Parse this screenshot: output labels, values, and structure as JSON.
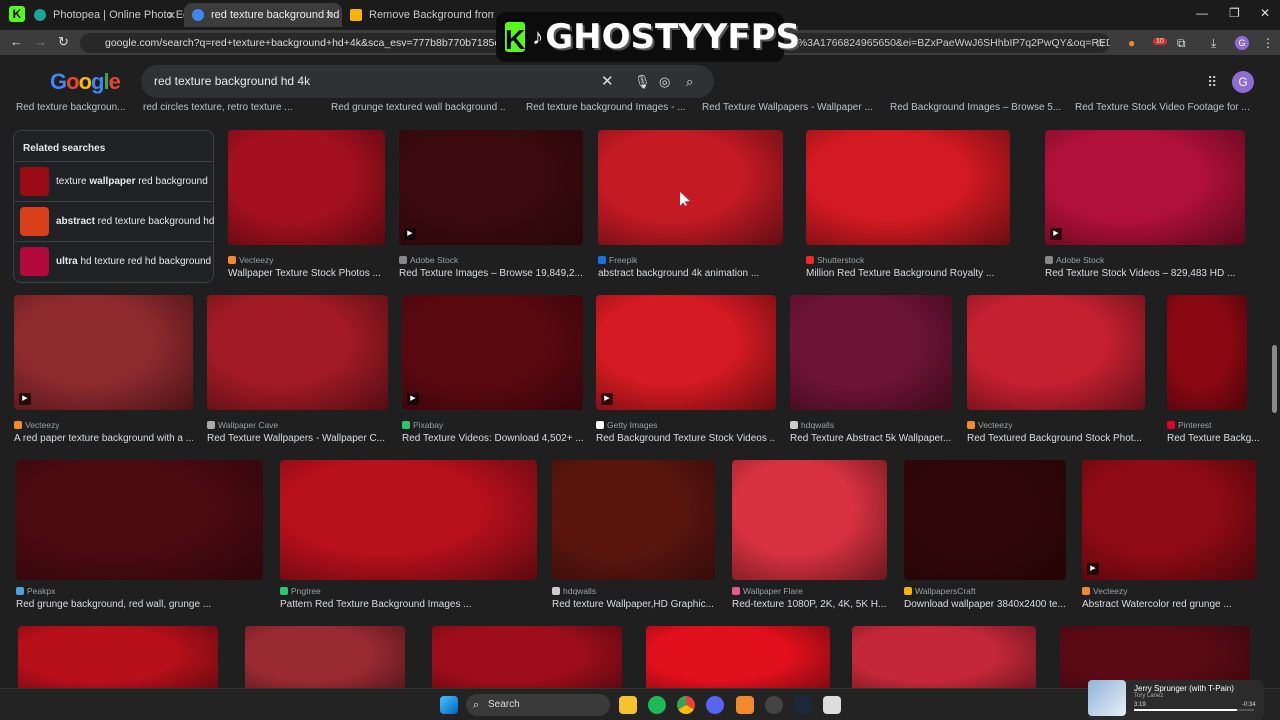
{
  "tabs": [
    {
      "label": "Photopea | Online Photo Editor",
      "color": "#18a497"
    },
    {
      "label": "red texture background hd 4k",
      "color": "#4285f4"
    },
    {
      "label": "Remove Background from Imag",
      "color": "#f4b400"
    }
  ],
  "address": {
    "url": "google.com/search?q=red+texture+background+hd+4k&sca_esv=777b8b770b7185e7&udm=2",
    "url_tail": "g%3A1766824965650&ei=BZxPaeWwJ6SHhbIP7q2PwQY&oq=RED+T...",
    "ext_badge": "10",
    "profile_letter": "G"
  },
  "overlay": {
    "brand": "GHOSTYYFPS",
    "k": "K"
  },
  "google": {
    "logo": "Google",
    "query": "red texture background hd 4k",
    "profile_letter": "G"
  },
  "top_captions": [
    "Red texture backgroun...",
    "red circles texture, retro texture ...",
    "Red grunge textured wall background ...",
    "Red texture background Images - ...",
    "Red Texture Wallpapers - Wallpaper ...",
    "Red Background Images – Browse 5...",
    "Red Texture Stock Video Footage for ..."
  ],
  "related": {
    "heading": "Related searches",
    "items": [
      {
        "pre": "texture ",
        "bold": "wallpaper",
        "post": " red background",
        "color": "#9a0c14"
      },
      {
        "pre": "",
        "bold": "abstract",
        "post": " red texture background hd",
        "color": "#d8401a"
      },
      {
        "pre": "",
        "bold": "ultra",
        "post": " hd texture red hd background",
        "color": "#b10a3a"
      }
    ]
  },
  "rows": [
    [
      {
        "source": "Vecteezy",
        "title": "Wallpaper Texture Stock Photos ...",
        "color": "#a5101e",
        "icon": "#f28b2c",
        "video": false
      },
      {
        "source": "Adobe Stock",
        "title": "Red Texture Images – Browse 19,849,2...",
        "color": "#3a0a0e",
        "icon": "#888",
        "video": true
      },
      {
        "source": "Freepik",
        "title": "abstract background 4k animation ...",
        "color": "#c41a24",
        "icon": "#1273eb",
        "video": false
      },
      {
        "source": "Shutterstock",
        "title": "Million Red Texture Background Royalty ...",
        "color": "#d31a22",
        "icon": "#ee2b24",
        "video": false
      },
      {
        "source": "Adobe Stock",
        "title": "Red Texture Stock Videos – 829,483 HD ...",
        "color": "#b0103a",
        "icon": "#888",
        "video": true
      }
    ],
    [
      {
        "source": "Vecteezy",
        "title": "A red paper texture background with a ...",
        "color": "#8d2a2e",
        "icon": "#f28b2c",
        "video": true
      },
      {
        "source": "Wallpaper Cave",
        "title": "Red Texture Wallpapers - Wallpaper C...",
        "color": "#a11a24",
        "icon": "#aaa",
        "video": false
      },
      {
        "source": "Pixabay",
        "title": "Red Texture Videos: Download 4,502+ ...",
        "color": "#5a0810",
        "icon": "#2ec66d",
        "video": true
      },
      {
        "source": "Getty Images",
        "title": "Red Background Texture Stock Videos ...",
        "color": "#d41a22",
        "icon": "#fff",
        "video": true
      },
      {
        "source": "hdqwalls",
        "title": "Red Texture Abstract 5k Wallpaper...",
        "color": "#6d1436",
        "icon": "#ccc",
        "video": false
      },
      {
        "source": "Vecteezy",
        "title": "Red Textured Background Stock Phot...",
        "color": "#c42030",
        "icon": "#f28b2c",
        "video": false
      },
      {
        "source": "Pinterest",
        "title": "Red Texture Backg...",
        "color": "#8a0812",
        "icon": "#e60023",
        "video": false
      }
    ],
    [
      {
        "source": "Peakpx",
        "title": "Red grunge background, red wall, grunge ...",
        "color": "#4a0a10",
        "icon": "#4aa3df",
        "video": false
      },
      {
        "source": "Pngtree",
        "title": "Pattern Red Texture Background Images ...",
        "color": "#b8101c",
        "icon": "#2ec66d",
        "video": false
      },
      {
        "source": "hdqwalls",
        "title": "Red texture Wallpaper,HD Graphic...",
        "color": "#5a160e",
        "icon": "#ccc",
        "video": false
      },
      {
        "source": "Wallpaper Flare",
        "title": "Red-texture 1080P, 2K, 4K, 5K H...",
        "color": "#d83240",
        "icon": "#e85a8a",
        "video": false
      },
      {
        "source": "WallpapersCraft",
        "title": "Download wallpaper 3840x2400 te...",
        "color": "#300608",
        "icon": "#f4b400",
        "video": false
      },
      {
        "source": "Vecteezy",
        "title": "Abstract Watercolor red grunge ...",
        "color": "#8e0a14",
        "icon": "#f28b2c",
        "video": true
      }
    ],
    [
      {
        "color": "#b8101a"
      },
      {
        "color": "#9a2a32"
      },
      {
        "color": "#9e0e1a"
      },
      {
        "color": "#e0101c"
      },
      {
        "color": "#c42838"
      },
      {
        "color": "#5a0a14"
      }
    ]
  ],
  "taskbar": {
    "search": "Search"
  },
  "media": {
    "title": "Jerry Sprunger (with T-Pain)",
    "artist": "Tory Lanez",
    "elapsed": "3:19",
    "remaining": "-0:34",
    "progress": 0.86
  }
}
